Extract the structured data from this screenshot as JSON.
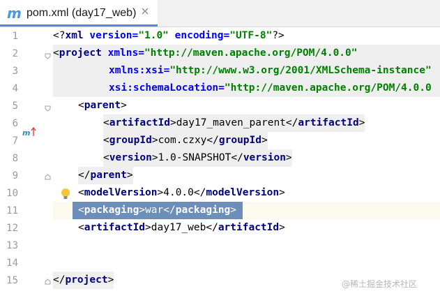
{
  "tab": {
    "title": "pom.xml (day17_web)",
    "icon": "maven-m-icon",
    "accent": "#4d8fdf"
  },
  "gutter": {
    "line_numbers": [
      "1",
      "2",
      "3",
      "4",
      "5",
      "6",
      "7",
      "8",
      "9",
      "10",
      "11",
      "12",
      "13",
      "14",
      "15"
    ],
    "markers": {
      "line5": "m",
      "line10": "lightbulb-icon"
    }
  },
  "code": {
    "l1": {
      "a": "<?",
      "b": "xml",
      "c": " version=",
      "d": "\"1.0\"",
      "e": " encoding=",
      "f": "\"UTF-8\"",
      "g": "?>"
    },
    "l2": {
      "a": "<",
      "b": "project",
      "c": " xmlns=",
      "d": "\"http://maven.apache.org/POM/4.0.0\""
    },
    "l3": {
      "a": "xmlns:",
      "b": "xsi",
      "c": "=",
      "d": "\"http://www.w3.org/2001/XMLSchema-instance\""
    },
    "l4": {
      "a": "xsi",
      "b": ":schemaLocation=",
      "c": "\"http://maven.apache.org/POM/4.0.0"
    },
    "l5": {
      "a": "<",
      "b": "parent",
      "c": ">"
    },
    "l6": {
      "open": "artifactId",
      "value": "day17_maven_parent",
      "close": "artifactId"
    },
    "l7": {
      "open": "groupId",
      "value": "com.czxy",
      "close": "groupId"
    },
    "l8": {
      "open": "version",
      "value": "1.0-SNAPSHOT",
      "close": "version"
    },
    "l9": {
      "a": "</",
      "b": "parent",
      "c": ">"
    },
    "l10": {
      "open": "modelVersion",
      "value": "4.0.0",
      "close": "modelVersion"
    },
    "l11": {
      "open": "packaging",
      "value": "war",
      "close": "packaging"
    },
    "l12": {
      "open": "artifactId",
      "value": "day17_web",
      "close": "artifactId"
    },
    "l15": {
      "a": "</",
      "b": "project",
      "c": ">"
    }
  },
  "watermark": "@稀土掘金技术社区"
}
